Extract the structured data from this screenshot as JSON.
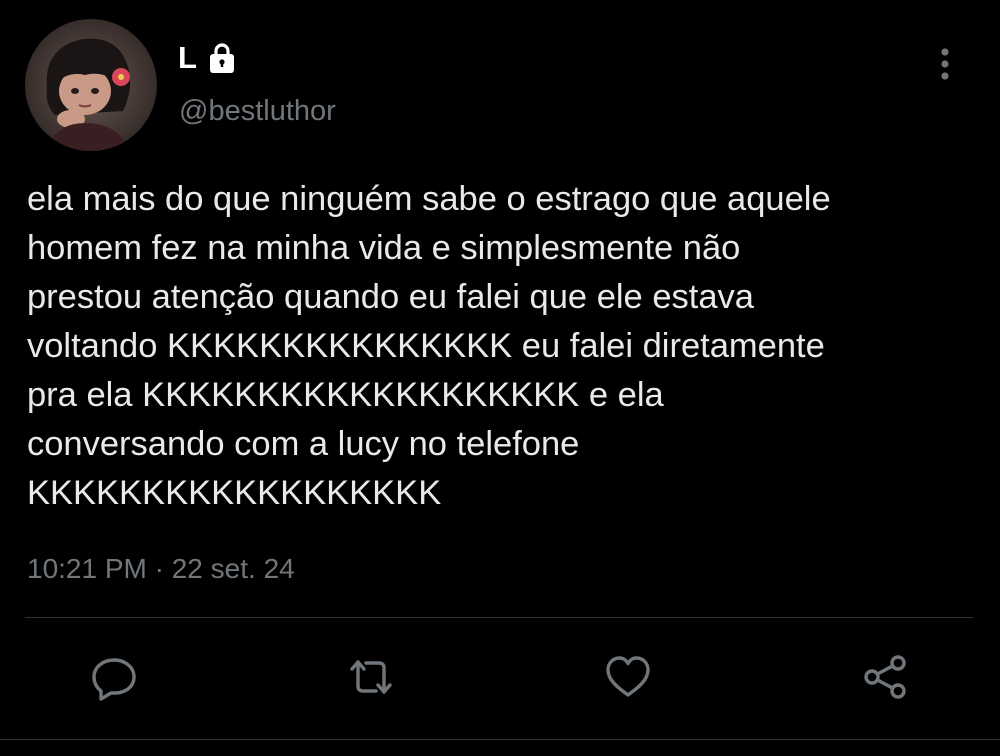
{
  "author": {
    "display_name": "L",
    "handle": "@bestluthor",
    "avatar_icon": "avatar-illustration",
    "protected_icon": "lock-icon"
  },
  "tweet": {
    "text": "ela mais do que ninguém sabe o estrago que aquele\nhomem fez na minha vida e simplesmente não\nprestou atenção quando eu falei que ele estava\nvoltando KKKKKKKKKKKKKKK eu falei diretamente\npra ela KKKKKKKKKKKKKKKKKKK e ela\nconversando com a lucy no telefone\nKKKKKKKKKKKKKKKKKK",
    "timestamp": "10:21 PM · 22 set. 24"
  },
  "actions": [
    {
      "name": "reply",
      "icon": "reply-icon"
    },
    {
      "name": "retweet",
      "icon": "retweet-icon"
    },
    {
      "name": "like",
      "icon": "heart-icon"
    },
    {
      "name": "share",
      "icon": "share-icon"
    }
  ],
  "colors": {
    "background": "#000000",
    "primary_text": "#e7e9ea",
    "secondary_text": "#71767b",
    "divider": "#2f3336"
  }
}
